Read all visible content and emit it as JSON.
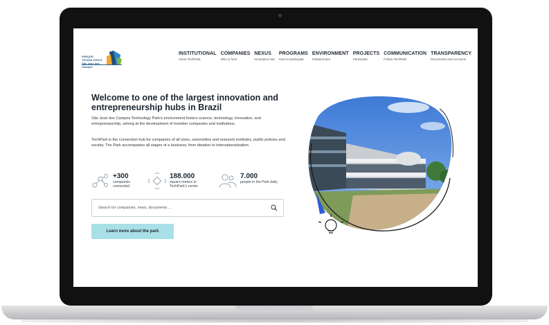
{
  "logo": {
    "text": "PARQUE TECNOLÓGICO São José dos Campos"
  },
  "nav": [
    {
      "label": "INSTITUTIONAL",
      "sub": "About TechPark"
    },
    {
      "label": "COMPANIES",
      "sub": "Who is here"
    },
    {
      "label": "NEXUS",
      "sub": "Innovation hub"
    },
    {
      "label": "PROGRAMS",
      "sub": "How to participate"
    },
    {
      "label": "ENVIRONMENT",
      "sub": "Infrastructure"
    },
    {
      "label": "PROJECTS",
      "sub": "Participate"
    },
    {
      "label": "COMMUNICATION",
      "sub": "Follow TechPark"
    },
    {
      "label": "TRANSPARENCY",
      "sub": "Documents and Accounts"
    }
  ],
  "hero": {
    "headline": "Welcome to one of the largest innovation and entrepreneurship hubs in Brazil",
    "para1": "São José dos Campos Technology Park's environment fosters science, technology, innovation, and entrepreneurship, aiming at the development of member companies and institutions.",
    "para2": "TechPark is the connection hub for companies of all sizes, universities and research institutes, public policies and society. The Park accompanies all stages of a business, from ideation to internationalization."
  },
  "stats": [
    {
      "number": "+300",
      "caption": "companies connected",
      "icon": "network-icon"
    },
    {
      "number": "188.000",
      "caption": "square meters in TechPark's center",
      "icon": "area-arrows-icon"
    },
    {
      "number": "7.000",
      "caption": "people in the Park daily",
      "icon": "people-icon"
    }
  ],
  "search": {
    "placeholder": "Search for companies, news, documents ..."
  },
  "cta": {
    "label": "Learn more about the park"
  },
  "colors": {
    "accent": "#a9dfe6",
    "text": "#1b2530",
    "brand": "#2b5f8a"
  }
}
